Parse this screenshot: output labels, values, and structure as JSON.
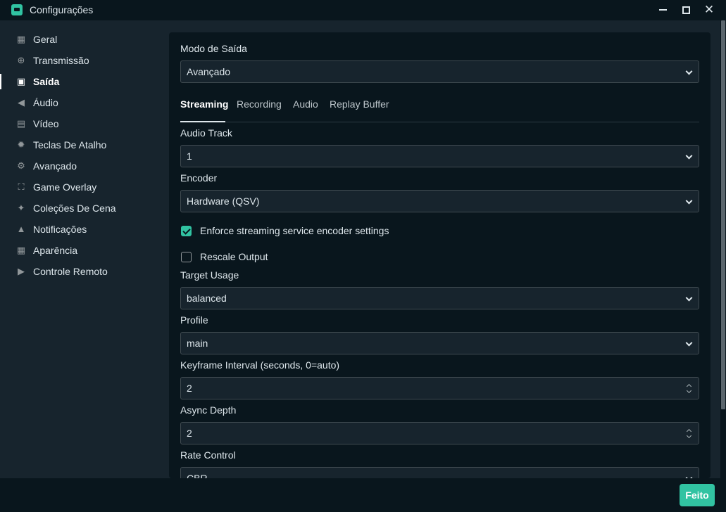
{
  "window": {
    "title": "Configurações",
    "icons": {
      "app": "streamlabs-logo-icon",
      "minimize": "minimize-icon",
      "maximize": "maximize-icon",
      "close": "close-icon"
    },
    "close_glyph": "✕"
  },
  "sidebar": {
    "items": [
      {
        "label": "Geral",
        "icon": "grid-icon",
        "glyph": "▦",
        "active": false
      },
      {
        "label": "Transmissão",
        "icon": "globe-icon",
        "glyph": "⊕",
        "active": false
      },
      {
        "label": "Saída",
        "icon": "chip-icon",
        "glyph": "▣",
        "active": true
      },
      {
        "label": "Áudio",
        "icon": "speaker-icon",
        "glyph": "◀",
        "active": false
      },
      {
        "label": "Vídeo",
        "icon": "film-icon",
        "glyph": "▤",
        "active": false
      },
      {
        "label": "Teclas De Atalho",
        "icon": "gear-icon",
        "glyph": "✹",
        "active": false
      },
      {
        "label": "Avançado",
        "icon": "gears-icon",
        "glyph": "⚙",
        "active": false
      },
      {
        "label": "Game Overlay",
        "icon": "expand-icon",
        "glyph": "⛶",
        "active": false
      },
      {
        "label": "Coleções De Cena",
        "icon": "magic-wand-icon",
        "glyph": "✦",
        "active": false
      },
      {
        "label": "Notificações",
        "icon": "bell-icon",
        "glyph": "▲",
        "active": false
      },
      {
        "label": "Aparência",
        "icon": "palette-icon",
        "glyph": "▦",
        "active": false
      },
      {
        "label": "Controle Remoto",
        "icon": "play-circle-icon",
        "glyph": "▶",
        "active": false
      }
    ]
  },
  "main": {
    "output_mode": {
      "label": "Modo de Saída",
      "value": "Avançado"
    },
    "tabs": [
      {
        "label": "Streaming",
        "active": true
      },
      {
        "label": "Recording",
        "active": false
      },
      {
        "label": "Audio",
        "active": false
      },
      {
        "label": "Replay Buffer",
        "active": false
      }
    ],
    "audio_track": {
      "label": "Audio Track",
      "value": "1"
    },
    "encoder": {
      "label": "Encoder",
      "value": "Hardware (QSV)"
    },
    "enforce_settings": {
      "label": "Enforce streaming service encoder settings",
      "checked": true
    },
    "rescale_output": {
      "label": "Rescale Output",
      "checked": false
    },
    "target_usage": {
      "label": "Target Usage",
      "value": "balanced"
    },
    "profile": {
      "label": "Profile",
      "value": "main"
    },
    "keyframe_interval": {
      "label": "Keyframe Interval (seconds, 0=auto)",
      "value": "2"
    },
    "async_depth": {
      "label": "Async Depth",
      "value": "2"
    },
    "rate_control": {
      "label": "Rate Control",
      "value": "CBR"
    }
  },
  "footer": {
    "done_label": "Feito"
  },
  "colors": {
    "accent": "#31c3a2",
    "background": "#17242d",
    "panel": "#09161d",
    "text": "#dee7ec"
  }
}
